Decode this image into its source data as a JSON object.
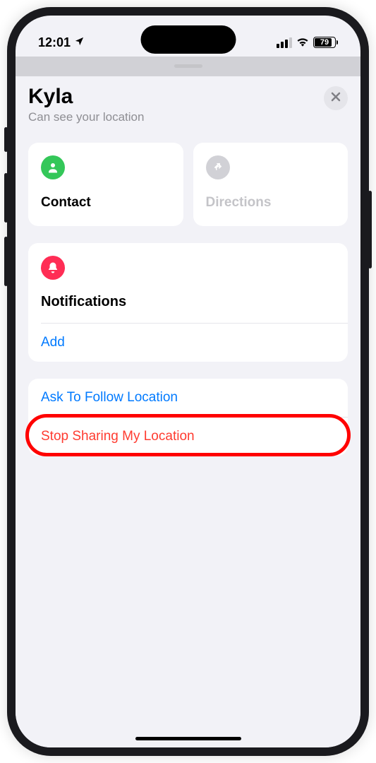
{
  "statusBar": {
    "time": "12:01",
    "batteryPercent": "79"
  },
  "header": {
    "title": "Kyla",
    "subtitle": "Can see your location"
  },
  "tiles": {
    "contact": {
      "label": "Contact"
    },
    "directions": {
      "label": "Directions"
    }
  },
  "notifications": {
    "title": "Notifications",
    "addLabel": "Add"
  },
  "actions": {
    "askFollow": "Ask To Follow Location",
    "stopSharing": "Stop Sharing My Location"
  }
}
